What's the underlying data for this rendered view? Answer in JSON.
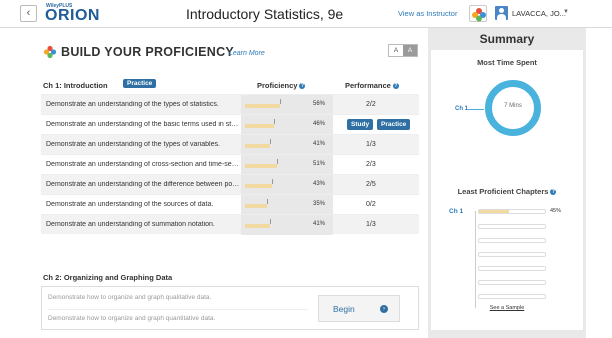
{
  "header": {
    "logo_small": "WileyPLUS",
    "logo_big": "ORION",
    "course_title": "Introductory Statistics, 9e",
    "view_as_instructor": "View as Instructor",
    "user_name": "LAVACCA, JO..."
  },
  "proficiency": {
    "title": "BUILD YOUR PROFICIENCY",
    "learn_more": "Learn More",
    "font_small": "A",
    "font_large": "A",
    "chapter1": {
      "title": "Ch 1: Introduction",
      "practice_label": "Practice",
      "proficiency_header": "Proficiency",
      "performance_header": "Performance",
      "rows": [
        {
          "desc": "Demonstrate an understanding of the types of statistics.",
          "pct": "56%",
          "prof": 0.56,
          "perf": "2/2"
        },
        {
          "desc": "Demonstrate an understanding of the basic terms used in statistics.",
          "pct": "46%",
          "prof": 0.46,
          "perf": "",
          "study": "Study",
          "practice": "Practice"
        },
        {
          "desc": "Demonstrate an understanding of the types of variables.",
          "pct": "41%",
          "prof": 0.41,
          "perf": "1/3"
        },
        {
          "desc": "Demonstrate an understanding of cross-section and time-series data.",
          "pct": "51%",
          "prof": 0.51,
          "perf": "2/3"
        },
        {
          "desc": "Demonstrate an understanding of the difference between population and sample.",
          "pct": "43%",
          "prof": 0.43,
          "perf": "2/5"
        },
        {
          "desc": "Demonstrate an understanding of the sources of data.",
          "pct": "35%",
          "prof": 0.35,
          "perf": "0/2"
        },
        {
          "desc": "Demonstrate an understanding of summation notation.",
          "pct": "41%",
          "prof": 0.41,
          "perf": "1/3"
        }
      ]
    },
    "chapter2": {
      "title": "Ch 2: Organizing and Graphing Data",
      "items": [
        "Demonstrate how to organize and graph qualitative data.",
        "Demonstrate how to organize and graph quantitative data."
      ],
      "begin_label": "Begin"
    }
  },
  "summary": {
    "title": "Summary",
    "most_time_spent": "Most Time Spent",
    "donut_center": "7 Mins",
    "donut_chapter": "Ch 1",
    "least_proficient": "Least Proficient Chapters",
    "lp_chapter": "Ch 1",
    "lp_pct": "45%",
    "lp_value": 0.45,
    "see_sample": "See a Sample"
  },
  "colors": {
    "brand_blue": "#1f5d96",
    "button_blue": "#2f6fa3",
    "link_blue": "#2d7ab8",
    "donut_cyan": "#4ab3dd",
    "bar_tan": "#f2d9a0"
  }
}
